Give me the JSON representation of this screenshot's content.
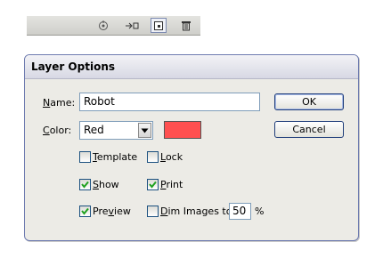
{
  "palette": {
    "icons": [
      "locate-object-icon",
      "make-clipping-mask-icon",
      "new-layer-icon",
      "delete-layer-icon"
    ]
  },
  "dialog": {
    "title": "Layer Options",
    "name": {
      "label": "Name:",
      "accel": "N",
      "rest": "ame:",
      "value": "Robot"
    },
    "color": {
      "label": "Color:",
      "accel": "C",
      "rest": "olor:",
      "value": "Red",
      "swatch": "#ff5050"
    },
    "buttons": {
      "ok": "OK",
      "cancel": "Cancel"
    },
    "options": {
      "template": {
        "label": "Template",
        "accel": "T",
        "rest": "emplate",
        "checked": false
      },
      "lock": {
        "label": "Lock",
        "accel": "L",
        "rest": "ock",
        "checked": false
      },
      "show": {
        "label": "Show",
        "accel": "S",
        "rest": "how",
        "checked": true
      },
      "print": {
        "label": "Print",
        "accel": "P",
        "rest": "rint",
        "checked": true
      },
      "preview": {
        "label": "Preview",
        "pre": "Pre",
        "accel": "v",
        "rest": "iew",
        "checked": true
      },
      "dim": {
        "label": "Dim Images to:",
        "accel": "D",
        "rest": "im Images to:",
        "checked": false,
        "value": "50",
        "unit": "%"
      }
    }
  }
}
